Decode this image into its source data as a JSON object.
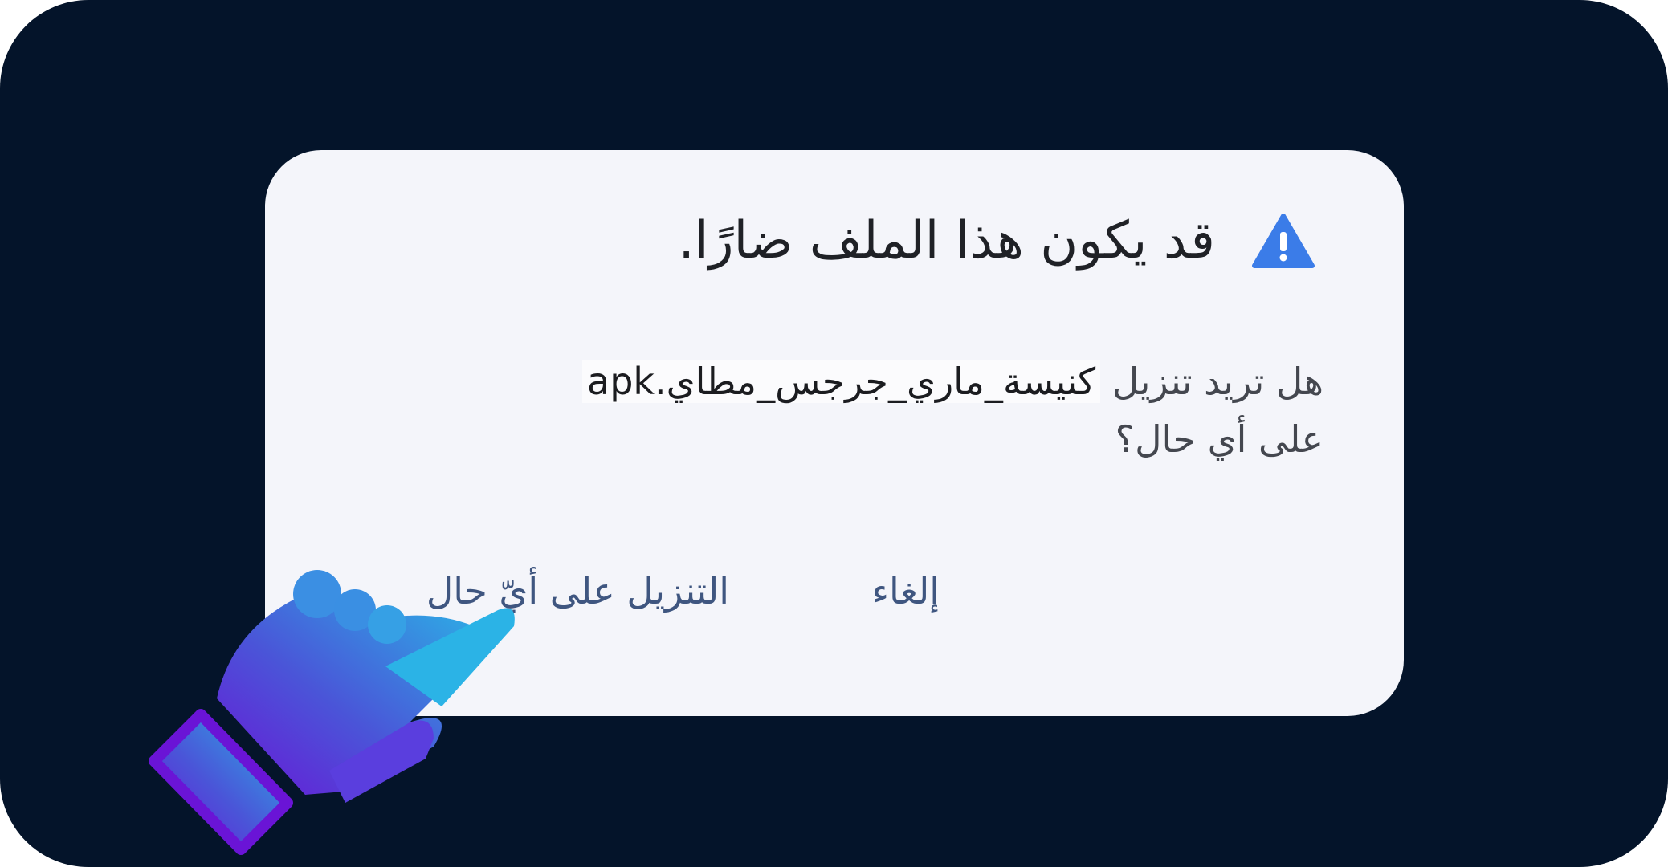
{
  "dialog": {
    "title": "قد يكون هذا الملف ضارًا.",
    "message_prefix": "هل تريد تنزيل ",
    "filename": "كنيسة_ماري_جرجس_مطاي.apk",
    "message_suffix": " على أي حال؟",
    "cancel_label": "إلغاء",
    "download_anyway_label": "التنزيل على أيّ حال"
  },
  "icons": {
    "warning": "warning-triangle-icon",
    "pointer": "pointing-hand-icon"
  },
  "colors": {
    "background": "#04142a",
    "dialog": "#f4f5fa",
    "warning": "#3b7ce8",
    "button_text": "#3f5680",
    "hand_gradient_start": "#2bb3e6",
    "hand_gradient_end": "#6a14d6"
  }
}
